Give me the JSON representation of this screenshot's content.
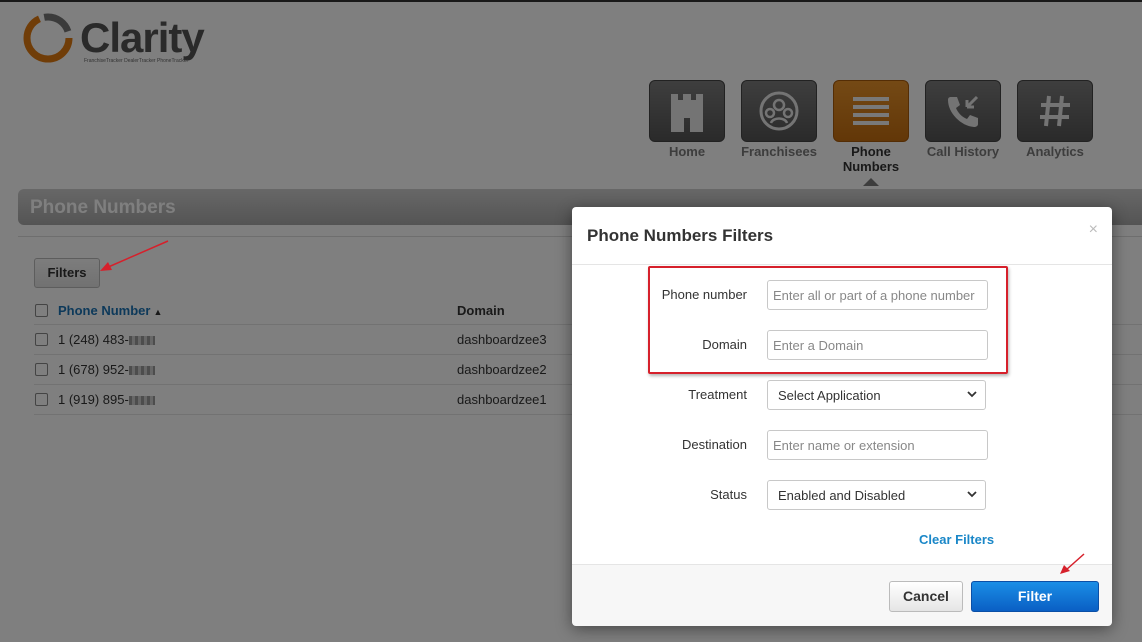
{
  "logo": {
    "text": "Clarity",
    "tagline": "FranchiseTracker  DealerTracker  PhoneTracker"
  },
  "nav": {
    "items": [
      {
        "label": "Home",
        "icon": "castle-icon"
      },
      {
        "label": "Franchisees",
        "icon": "group-icon"
      },
      {
        "label": "Phone Numbers",
        "icon": "list-icon",
        "active": true
      },
      {
        "label": "Call History",
        "icon": "phone-incoming-icon"
      },
      {
        "label": "Analytics",
        "icon": "hash-icon"
      }
    ]
  },
  "page": {
    "title": "Phone Numbers",
    "filters_button": "Filters"
  },
  "table": {
    "headers": {
      "phone": "Phone Number",
      "domain": "Domain"
    },
    "rows": [
      {
        "phone": "1 (248) 483-",
        "domain": "dashboardzee3"
      },
      {
        "phone": "1 (678) 952-",
        "domain": "dashboardzee2"
      },
      {
        "phone": "1 (919) 895-",
        "domain": "dashboardzee1"
      }
    ]
  },
  "modal": {
    "title": "Phone Numbers Filters",
    "close": "×",
    "fields": {
      "phone": {
        "label": "Phone number",
        "placeholder": "Enter all or part of a phone number",
        "value": ""
      },
      "domain": {
        "label": "Domain",
        "placeholder": "Enter a Domain",
        "value": ""
      },
      "treatment": {
        "label": "Treatment",
        "selected": "Select Application"
      },
      "destination": {
        "label": "Destination",
        "placeholder": "Enter name or extension",
        "value": ""
      },
      "status": {
        "label": "Status",
        "selected": "Enabled and Disabled"
      }
    },
    "clear_filters": "Clear Filters",
    "cancel": "Cancel",
    "filter": "Filter"
  },
  "colors": {
    "accent_orange": "#d8801c",
    "primary_blue": "#0a6fd6",
    "link_blue": "#1a87c8",
    "annotation_red": "#d6202b"
  }
}
